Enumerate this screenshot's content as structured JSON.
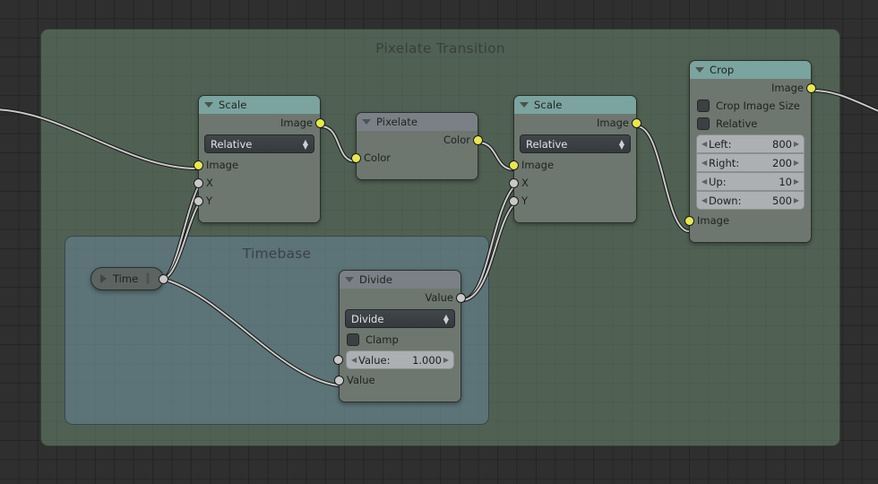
{
  "editor": {
    "name": "blender-node-editor",
    "background_color": "#2f2f2f"
  },
  "frames": {
    "main": {
      "label": "Pixelate Transition",
      "color": "#708f74"
    },
    "timebase": {
      "label": "Timebase",
      "color": "#68869b"
    }
  },
  "nodes": {
    "scale1": {
      "title": "Scale",
      "header_color": "#7ba39f",
      "outputs": [
        {
          "label": "Image",
          "socket": "yellow",
          "connected": true
        }
      ],
      "space_dropdown": "Relative",
      "inputs": [
        {
          "label": "Image",
          "socket": "yellow",
          "connected": true
        },
        {
          "label": "X",
          "socket": "gray",
          "connected": true
        },
        {
          "label": "Y",
          "socket": "gray",
          "connected": true
        }
      ]
    },
    "pixelate": {
      "title": "Pixelate",
      "header_color": "#7b8086",
      "outputs": [
        {
          "label": "Color",
          "socket": "yellow",
          "connected": true
        }
      ],
      "inputs": [
        {
          "label": "Color",
          "socket": "yellow",
          "connected": true
        }
      ]
    },
    "scale2": {
      "title": "Scale",
      "header_color": "#7ba39f",
      "outputs": [
        {
          "label": "Image",
          "socket": "yellow",
          "connected": true
        }
      ],
      "space_dropdown": "Relative",
      "inputs": [
        {
          "label": "Image",
          "socket": "yellow",
          "connected": true
        },
        {
          "label": "X",
          "socket": "gray",
          "connected": true
        },
        {
          "label": "Y",
          "socket": "gray",
          "connected": true
        }
      ]
    },
    "crop": {
      "title": "Crop",
      "header_color": "#7ba39f",
      "outputs": [
        {
          "label": "Image",
          "socket": "yellow",
          "connected": true
        }
      ],
      "checkboxes": [
        {
          "label": "Crop Image Size",
          "checked": false
        },
        {
          "label": "Relative",
          "checked": false
        }
      ],
      "fields": [
        {
          "label": "Left:",
          "value": "800"
        },
        {
          "label": "Right:",
          "value": "200"
        },
        {
          "label": "Up:",
          "value": "10"
        },
        {
          "label": "Down:",
          "value": "500"
        }
      ],
      "inputs": [
        {
          "label": "Image",
          "socket": "yellow",
          "connected": true
        }
      ]
    },
    "divide": {
      "title": "Divide",
      "header_color": "#7b8086",
      "outputs": [
        {
          "label": "Value",
          "socket": "gray",
          "connected": true
        }
      ],
      "operation_dropdown": "Divide",
      "checkboxes": [
        {
          "label": "Clamp",
          "checked": false
        }
      ],
      "fields": [
        {
          "label": "Value:",
          "value": "1.000"
        }
      ],
      "inputs": [
        {
          "label": "Value",
          "socket": "gray",
          "connected": true
        }
      ]
    },
    "time": {
      "title": "Time",
      "collapsed": true,
      "outputs": [
        {
          "label": "",
          "socket": "gray",
          "connected": true
        }
      ]
    }
  }
}
